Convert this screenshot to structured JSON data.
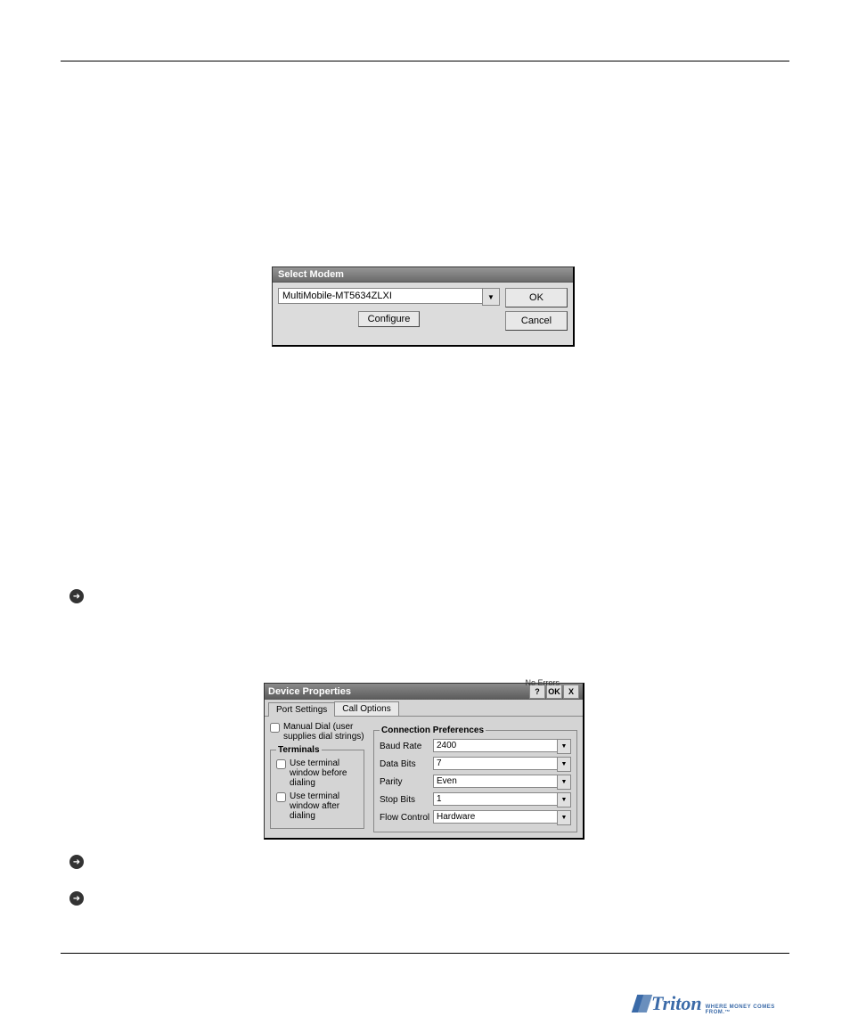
{
  "select_modem": {
    "title": "Select Modem",
    "modem_value": "MultiMobile-MT5634ZLXI",
    "configure_label": "Configure",
    "ok_label": "OK",
    "cancel_label": "Cancel"
  },
  "device_properties": {
    "title": "Device Properties",
    "help_label": "?",
    "ok_label": "OK",
    "close_label": "X",
    "status_hint": "No Errors",
    "tabs": {
      "port_settings": "Port Settings",
      "call_options": "Call Options"
    },
    "manual_dial_label": "Manual Dial (user supplies dial strings)",
    "terminals_legend": "Terminals",
    "term_before_label": "Use terminal window before dialing",
    "term_after_label": "Use terminal window after dialing",
    "prefs_legend": "Connection Preferences",
    "rows": {
      "baud": {
        "label": "Baud Rate",
        "value": "2400"
      },
      "data": {
        "label": "Data Bits",
        "value": "7"
      },
      "parity": {
        "label": "Parity",
        "value": "Even"
      },
      "stop": {
        "label": "Stop Bits",
        "value": "1"
      },
      "flow": {
        "label": "Flow Control",
        "value": "Hardware"
      }
    }
  },
  "footer": {
    "brand": "Triton",
    "tagline": "WHERE MONEY COMES FROM.™"
  }
}
